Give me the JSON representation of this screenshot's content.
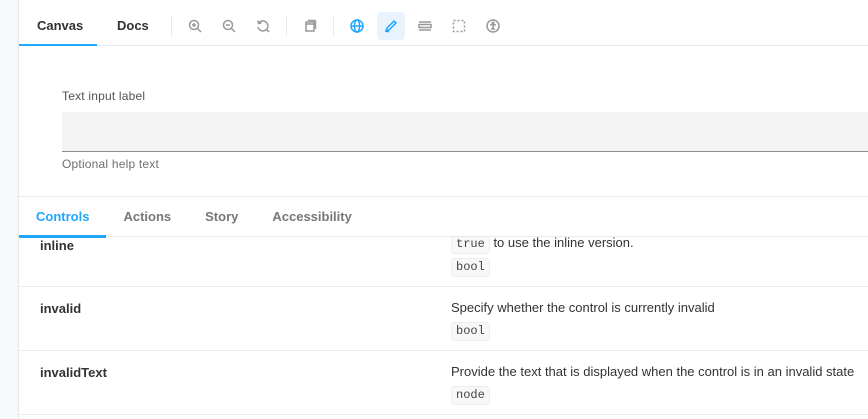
{
  "toolbar": {
    "tabs": [
      {
        "label": "Canvas",
        "active": true
      },
      {
        "label": "Docs",
        "active": false
      }
    ],
    "tools": [
      "zoom-in-icon",
      "zoom-out-icon",
      "zoom-reset-icon",
      "background-icon",
      "globe-icon",
      "pencil-icon",
      "outline-icon",
      "measure-icon",
      "accessibility-icon"
    ]
  },
  "preview": {
    "label": "Text input label",
    "value": "",
    "help_text": "Optional help text"
  },
  "addons": {
    "tabs": [
      {
        "label": "Controls",
        "active": true
      },
      {
        "label": "Actions",
        "active": false
      },
      {
        "label": "Story",
        "active": false
      },
      {
        "label": "Accessibility",
        "active": false
      }
    ],
    "rows": [
      {
        "name": "inline",
        "desc_code": "true",
        "desc": "to use the inline version.",
        "type": "bool"
      },
      {
        "name": "invalid",
        "desc": "Specify whether the control is currently invalid",
        "type": "bool"
      },
      {
        "name": "invalidText",
        "desc": "Provide the text that is displayed when the control is in an invalid state",
        "type": "node"
      }
    ]
  },
  "colors": {
    "accent": "#1ea7fd",
    "text": "#333333",
    "border": "#e6e9ee"
  }
}
